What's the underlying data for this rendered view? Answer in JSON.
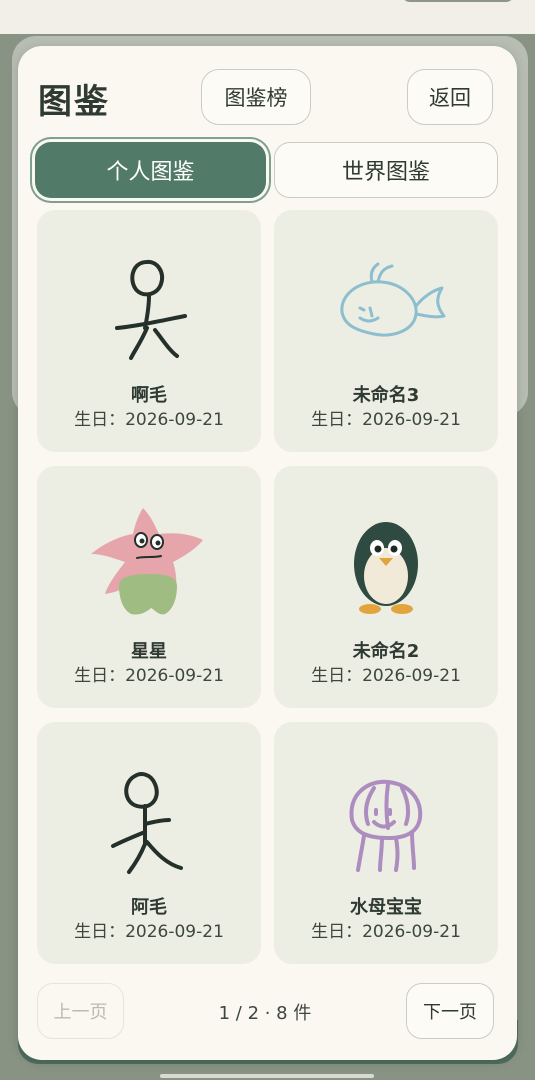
{
  "header": {
    "title": "图鉴",
    "rank_label": "图鉴榜",
    "back_label": "返回"
  },
  "tabs": [
    {
      "label": "个人图鉴",
      "active": true
    },
    {
      "label": "世界图鉴",
      "active": false
    }
  ],
  "items": [
    {
      "name": "啊毛",
      "birthday": "生日：2026-09-21",
      "icon": "stick-figure-icon"
    },
    {
      "name": "未命名3",
      "birthday": "生日：2026-09-21",
      "icon": "fish-doodle-icon"
    },
    {
      "name": "星星",
      "birthday": "生日：2026-09-21",
      "icon": "starfish-doodle-icon"
    },
    {
      "name": "未命名2",
      "birthday": "生日：2026-09-21",
      "icon": "penguin-icon"
    },
    {
      "name": "阿毛",
      "birthday": "生日：2026-09-21",
      "icon": "stick-figure-icon"
    },
    {
      "name": "水母宝宝",
      "birthday": "生日：2026-09-21",
      "icon": "jellyfish-doodle-icon"
    }
  ],
  "pager": {
    "prev_label": "上一页",
    "next_label": "下一页",
    "info": "1 / 2 · 8 件"
  },
  "colors": {
    "accent": "#527a68",
    "modal_bg": "#fbf8f1",
    "card_bg": "#eceee3",
    "backdrop": "#889383"
  }
}
